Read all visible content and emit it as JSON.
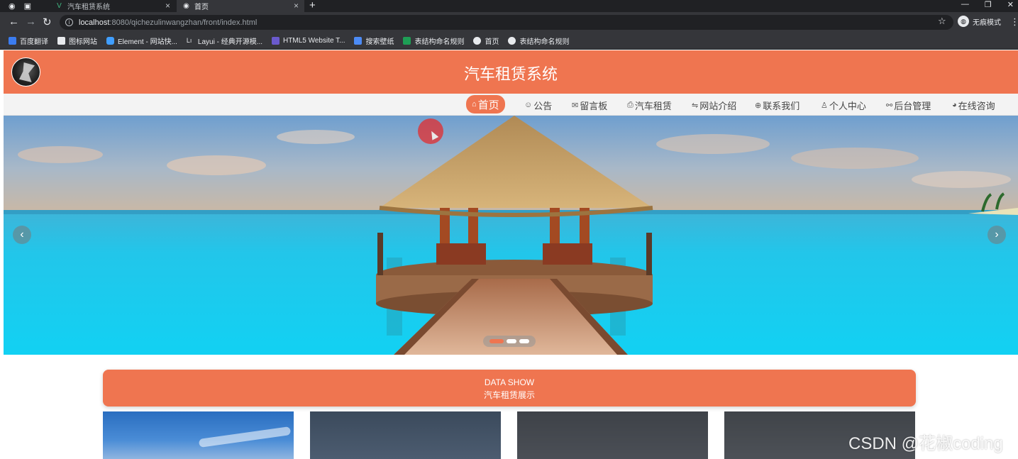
{
  "browser": {
    "tabs": [
      {
        "title": "汽车租赁系统",
        "icon": "vue-logo-icon"
      },
      {
        "title": "首页",
        "icon": "globe-icon"
      }
    ],
    "url_host": "localhost",
    "url_path": ":8080/qichezulinwangzhan/front/index.html",
    "incognito_label": "无痕模式",
    "bookmarks": [
      {
        "label": "百度翻译",
        "color": "#3b7cf0"
      },
      {
        "label": "图标网站",
        "color": "#e8eaed"
      },
      {
        "label": "Element - 网站快...",
        "color": "#409eff"
      },
      {
        "label": "Layui - 经典开源模...",
        "color": "#e8eaed"
      },
      {
        "label": "HTML5 Website T...",
        "color": "#6a5acd"
      },
      {
        "label": "搜索壁纸",
        "color": "#4c8bf5"
      },
      {
        "label": "表结构命名规则",
        "color": "#1e9e55"
      },
      {
        "label": "首页",
        "color": "#e8eaed"
      },
      {
        "label": "表结构命名规则",
        "color": "#e8eaed"
      }
    ]
  },
  "site": {
    "title": "汽车租赁系统",
    "accent_color": "#ef7550",
    "nav": [
      {
        "label": "首页",
        "icon": "home-icon",
        "glyph": "⌂",
        "active": true
      },
      {
        "label": "公告",
        "icon": "announcement-icon",
        "glyph": "☺",
        "active": false
      },
      {
        "label": "留言板",
        "icon": "mail-icon",
        "glyph": "✉",
        "active": false
      },
      {
        "label": "汽车租赁",
        "icon": "printer-icon",
        "glyph": "⎙",
        "active": false
      },
      {
        "label": "网站介绍",
        "icon": "sliders-icon",
        "glyph": "⇋",
        "active": false
      },
      {
        "label": "联系我们",
        "icon": "globe-icon",
        "glyph": "⊕",
        "active": false
      },
      {
        "label": "个人中心",
        "icon": "user-icon",
        "glyph": "♙",
        "active": false
      },
      {
        "label": "后台管理",
        "icon": "link-icon",
        "glyph": "⚯",
        "active": false
      },
      {
        "label": "在线咨询",
        "icon": "chat-icon",
        "glyph": "◕",
        "active": false
      }
    ],
    "carousel": {
      "slide_count": 3,
      "active_index": 0,
      "prev_glyph": "‹",
      "next_glyph": "›"
    },
    "datashow": {
      "title_en": "DATA SHOW",
      "title_cn": "汽车租赁展示"
    }
  },
  "watermark": "CSDN @花椒coding"
}
